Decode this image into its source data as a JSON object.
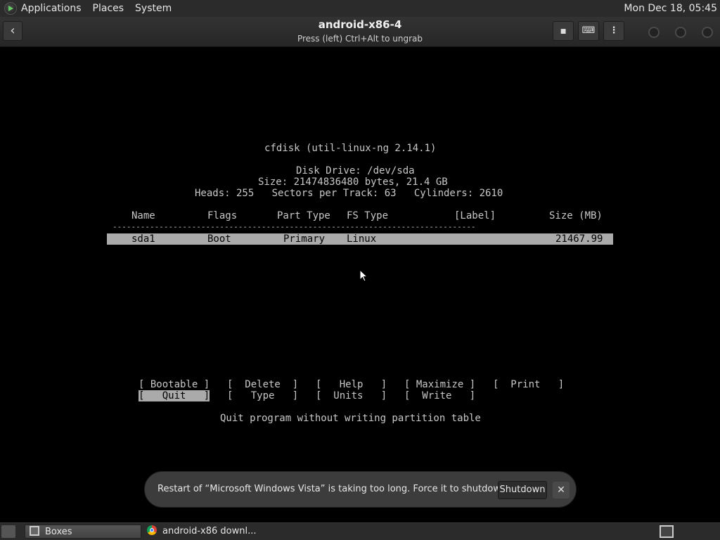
{
  "top_panel": {
    "menus": [
      "Applications",
      "Places",
      "System"
    ],
    "clock": "Mon Dec 18, 05:45"
  },
  "header": {
    "title": "android-x86-4",
    "subtitle": "Press (left) Ctrl+Alt to ungrab",
    "back_icon": "‹",
    "buttons": {
      "stop_icon": "■",
      "keyboard_icon": "⌨",
      "menu_icon": "⋮"
    }
  },
  "cfdisk": {
    "title": "cfdisk (util-linux-ng 2.14.1)",
    "disk_drive": "Disk Drive: /dev/sda",
    "size_line": "Size: 21474836480 bytes, 21.4 GB",
    "geometry": "Heads: 255   Sectors per Track: 63   Cylinders: 2610",
    "columns": {
      "name": "Name",
      "flags": "Flags",
      "part_type": "Part Type",
      "fs_type": "FS Type",
      "label": "[Label]",
      "size": "Size (MB)"
    },
    "separator": "------------------------------------------------------------------------------",
    "partition": {
      "name": "sda1",
      "flags": "Boot",
      "part_type": "Primary",
      "fs_type": "Linux",
      "size": "21467.99"
    },
    "menu": {
      "bootable": "[ Bootable ]",
      "delete": "[  Delete  ]",
      "help": "[   Help   ]",
      "maximize": "[ Maximize ]",
      "print": "[  Print   ]",
      "quit": "[   Quit   ]",
      "type": "[   Type   ]",
      "units": "[  Units   ]",
      "write": "[  Write   ]"
    },
    "help_text": "Quit program without writing partition table"
  },
  "notification": {
    "message": "Restart of “Microsoft Windows Vista” is taking too long. Force it to shutdown?",
    "button": "Shutdown",
    "close": "✕"
  },
  "taskbar": {
    "tasks": [
      "Boxes",
      "android-x86 downl..."
    ]
  }
}
